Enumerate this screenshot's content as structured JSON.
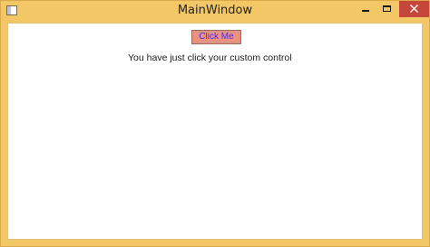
{
  "window": {
    "title": "MainWindow",
    "accent_color": "#f3c766",
    "close_color": "#c7463c"
  },
  "icons": {
    "app": "window-icon",
    "minimize": "minimize-icon",
    "maximize": "maximize-icon",
    "close": "close-icon"
  },
  "content": {
    "button_label": "Click Me",
    "message": "You have just click your custom control"
  }
}
